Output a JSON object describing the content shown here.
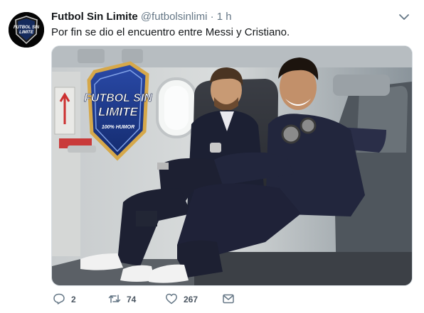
{
  "tweet": {
    "name": "Futbol Sin Limite",
    "handle": "@futbolsinlimi",
    "separator": "·",
    "time": "1 h",
    "text": "Por fin se dio el encuentro entre Messi y Cristiano."
  },
  "avatar": {
    "logo_text": "FUTBOL SIN LIMITE"
  },
  "media": {
    "badge_line1": "FUTBOL SIN",
    "badge_line2": "LIMITE",
    "badge_tagline": "100% HUMOR"
  },
  "actions": {
    "reply_count": "2",
    "retweet_count": "74",
    "like_count": "267"
  },
  "colors": {
    "text": "#14171a",
    "secondary": "#657786",
    "badge_blue": "#1f3a8a",
    "badge_gold": "#d6a84a"
  },
  "icons": [
    "chevron-down-icon",
    "reply-icon",
    "retweet-icon",
    "heart-icon",
    "envelope-icon"
  ]
}
